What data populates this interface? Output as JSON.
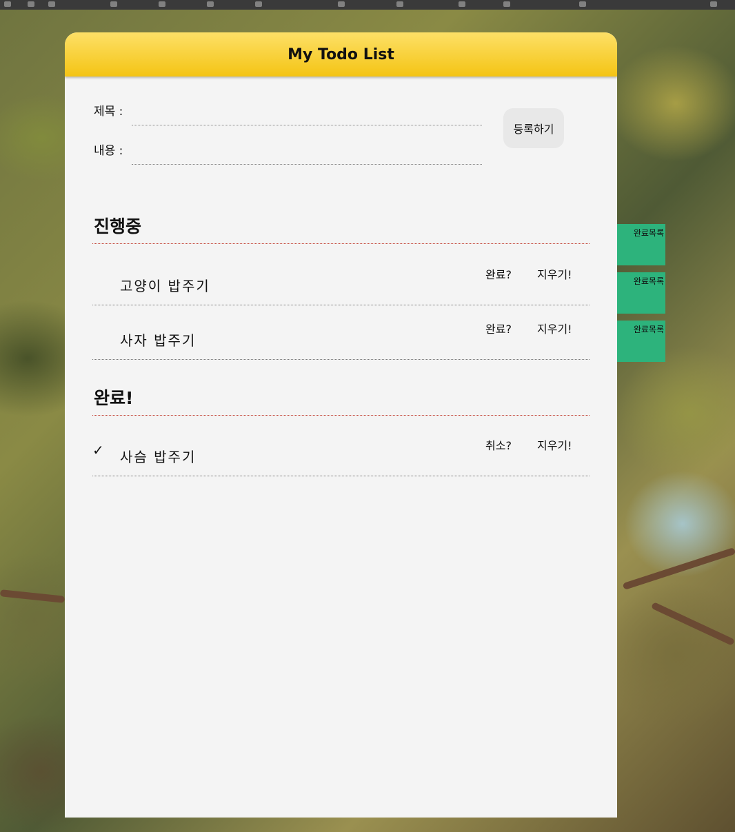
{
  "app": {
    "title": "My Todo List"
  },
  "form": {
    "title_label": "제목 :",
    "content_label": "내용 :",
    "title_value": "",
    "content_value": "",
    "submit_label": "등록하기"
  },
  "sections": {
    "in_progress": {
      "title": "진행중",
      "items": [
        {
          "title": "고양이 밥주기",
          "done_label": "완료?",
          "delete_label": "지우기!"
        },
        {
          "title": "사자 밥주기",
          "done_label": "완료?",
          "delete_label": "지우기!"
        }
      ]
    },
    "completed": {
      "title": "완료!",
      "items": [
        {
          "check": "✓",
          "title": "사슴 밥주기",
          "cancel_label": "취소?",
          "delete_label": "지우기!"
        }
      ]
    }
  },
  "side_tabs": [
    {
      "label": "완료목록"
    },
    {
      "label": "완료목록"
    },
    {
      "label": "완료목록"
    }
  ],
  "colors": {
    "header_yellow": "#f4c414",
    "side_tab_green": "#2db37c",
    "panel_bg": "#f4f4f4",
    "section_line_red": "#c0392b"
  }
}
